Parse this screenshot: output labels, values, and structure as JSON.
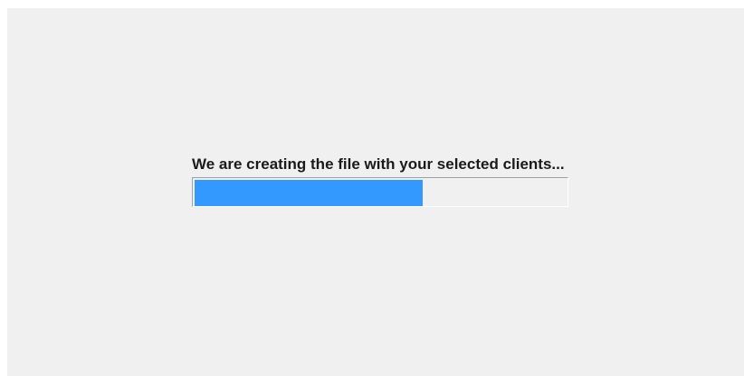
{
  "status": {
    "message": "We are creating the file with your selected clients..."
  },
  "progress": {
    "fraction": 0.615,
    "fill_color": "#3399ff",
    "track_color": "#f0f0f0"
  },
  "window": {
    "background_color": "#f0f0f0"
  }
}
